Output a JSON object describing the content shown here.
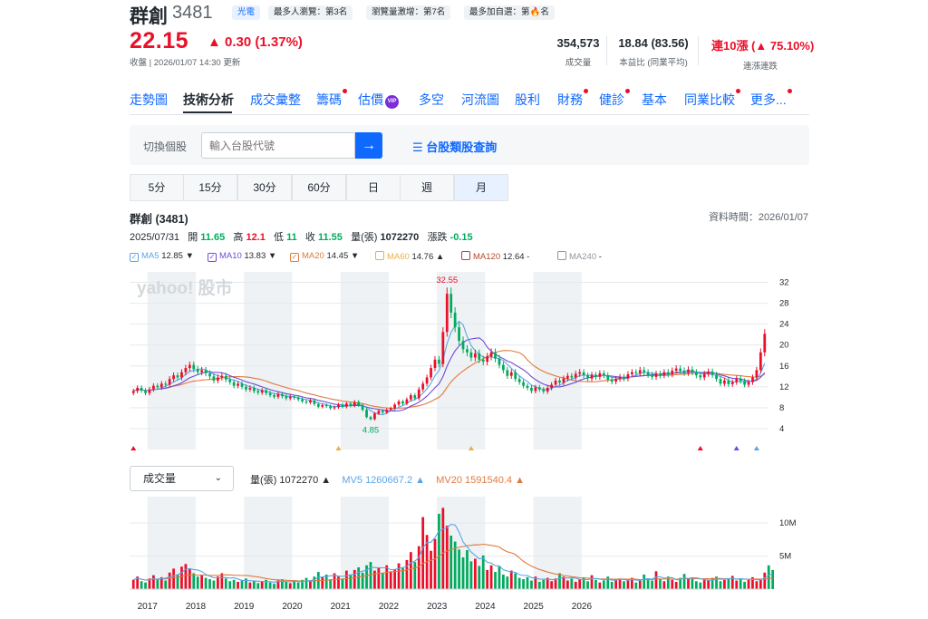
{
  "header": {
    "name": "群創",
    "code": "3481",
    "badges": [
      "光電",
      "最多人瀏覽：第3名",
      "瀏覽量激增：第7名",
      "最多加自選：第🔥名"
    ],
    "price": "22.15",
    "change": "▲ 0.30 (1.37%)",
    "updated": "收盤 | 2026/01/07 14:30 更新",
    "stats": [
      {
        "value": "354,573",
        "label": "成交量"
      },
      {
        "value": "18.84 (83.56)",
        "label": "本益比 (同業平均)"
      },
      {
        "value": "連10漲 (▲ 75.10%)",
        "label": "連漲連跌"
      }
    ]
  },
  "tabs": [
    "走勢圖",
    "技術分析",
    "成交彙整",
    "籌碼",
    "估價",
    "多空",
    "河流圖",
    "股利",
    "財務",
    "健診",
    "基本",
    "同業比較",
    "更多..."
  ],
  "active_tab": "技術分析",
  "vip_label": "VIP",
  "search": {
    "label": "切換個股",
    "placeholder": "輸入台股代號",
    "button_icon": "arrow-right-icon",
    "category_link": "台股類股查詢"
  },
  "periods": [
    "5分",
    "15分",
    "30分",
    "60分",
    "日",
    "週",
    "月"
  ],
  "active_period": "月",
  "chart_header": {
    "title": "群創 (3481)",
    "data_time": "資料時間：2026/01/07",
    "date": "2025/07/31",
    "open_label": "開",
    "open": "11.65",
    "high_label": "高",
    "high": "12.1",
    "low_label": "低",
    "low": "11",
    "close_label": "收",
    "close": "11.55",
    "vol_label": "量(張)",
    "vol": "1072270",
    "chg_label": "漲跌",
    "chg": "-0.15"
  },
  "ma_legend": [
    {
      "label": "MA5",
      "value": "12.85 ▼",
      "color": "#5aa5e8",
      "checked": true
    },
    {
      "label": "MA10",
      "value": "13.83 ▼",
      "color": "#6f4bd8",
      "checked": true
    },
    {
      "label": "MA20",
      "value": "14.45 ▼",
      "color": "#e07a3f",
      "checked": true
    },
    {
      "label": "MA60",
      "value": "14.76 ▲",
      "color": "#e8b04a",
      "checked": false
    },
    {
      "label": "MA120",
      "value": "12.64 -",
      "color": "#b7472a",
      "checked": false
    },
    {
      "label": "MA240",
      "value": "-",
      "color": "#8f969c",
      "checked": false
    }
  ],
  "volume_selector": "成交量",
  "volume_legend": {
    "vol": "量(張) 1072270 ▲",
    "mv5": "MV5 1260667.2 ▲",
    "mv20": "MV20 1591540.4 ▲"
  },
  "watermark": "yahoo! 股市",
  "colors": {
    "up": "#eb0f29",
    "down": "#00ab5e",
    "accent": "#0f69ff"
  },
  "chart_data": {
    "type": "candlestick",
    "y_ticks": [
      4,
      8,
      12,
      16,
      20,
      24,
      28,
      32
    ],
    "ylim": [
      0,
      34
    ],
    "x_ticks": [
      "2017",
      "2018",
      "2019",
      "2020",
      "2021",
      "2022",
      "2023",
      "2024",
      "2025",
      "2026"
    ],
    "annotations": [
      {
        "label": "32.55",
        "kind": "max"
      },
      {
        "label": "4.85",
        "kind": "min"
      }
    ],
    "close": [
      11.2,
      11.8,
      11.3,
      10.8,
      11.5,
      12.2,
      11.9,
      12.6,
      12.4,
      13.5,
      14.2,
      13.8,
      14.8,
      15.6,
      16.2,
      15.4,
      14.8,
      15.2,
      14.6,
      14.0,
      13.2,
      13.8,
      14.1,
      13.4,
      12.9,
      12.2,
      12.6,
      12.0,
      11.5,
      11.8,
      11.2,
      10.9,
      11.3,
      10.8,
      10.4,
      10.1,
      10.6,
      10.2,
      9.8,
      10.1,
      9.9,
      9.6,
      9.2,
      9.0,
      9.4,
      8.7,
      8.2,
      8.5,
      8.3,
      7.9,
      8.1,
      8.6,
      8.2,
      8.8,
      8.4,
      9.1,
      8.5,
      7.6,
      6.2,
      5.8,
      6.9,
      7.4,
      7.1,
      7.6,
      7.9,
      8.6,
      9.2,
      8.8,
      9.6,
      10.4,
      9.8,
      11.5,
      12.6,
      13.8,
      15.6,
      17.2,
      16.4,
      22.5,
      29.8,
      26.2,
      23.4,
      20.8,
      19.2,
      18.6,
      17.6,
      18.4,
      17.2,
      16.8,
      17.8,
      18.6,
      17.4,
      16.2,
      15.2,
      14.1,
      14.8,
      13.5,
      12.9,
      12.2,
      11.8,
      11.2,
      11.9,
      11.5,
      11.1,
      11.8,
      12.4,
      13.2,
      12.8,
      13.6,
      14.1,
      13.8,
      14.5,
      14.8,
      14.2,
      13.6,
      14.3,
      13.9,
      14.6,
      14.2,
      13.4,
      13.0,
      13.5,
      13.9,
      13.6,
      14.4,
      14.8,
      14.6,
      15.2,
      14.8,
      14.3,
      13.9,
      14.5,
      14.2,
      14.8,
      14.4,
      15.1,
      15.5,
      15.1,
      14.7,
      15.3,
      14.8,
      14.2,
      13.8,
      14.5,
      14.9,
      14.3,
      13.5,
      12.6,
      13.2,
      12.5,
      12.9,
      13.6,
      13.1,
      12.4,
      12.9,
      13.8,
      15.2,
      18.6,
      22.15
    ],
    "open": [
      10.8,
      11.2,
      11.8,
      11.3,
      10.8,
      11.5,
      12.2,
      11.9,
      12.6,
      12.4,
      13.5,
      14.2,
      13.8,
      14.8,
      15.6,
      16.2,
      15.4,
      14.8,
      15.2,
      14.6,
      14.0,
      13.2,
      13.8,
      14.1,
      13.4,
      12.9,
      12.2,
      12.6,
      12.0,
      11.5,
      11.8,
      11.2,
      10.9,
      11.3,
      10.8,
      10.4,
      10.1,
      10.6,
      10.2,
      9.8,
      10.1,
      9.9,
      9.6,
      9.2,
      9.0,
      9.4,
      8.7,
      8.2,
      8.5,
      8.3,
      7.9,
      8.1,
      8.6,
      8.2,
      8.8,
      8.4,
      9.1,
      8.5,
      7.6,
      6.2,
      5.8,
      6.9,
      7.4,
      7.1,
      7.6,
      7.9,
      8.6,
      9.2,
      8.8,
      9.6,
      10.4,
      9.8,
      11.5,
      12.6,
      13.8,
      15.6,
      17.2,
      16.4,
      22.5,
      29.8,
      26.2,
      23.4,
      20.8,
      19.2,
      18.6,
      17.6,
      18.4,
      17.2,
      16.8,
      17.8,
      18.6,
      17.4,
      16.2,
      15.2,
      14.1,
      14.8,
      13.5,
      12.9,
      12.2,
      11.8,
      11.2,
      11.9,
      11.5,
      11.1,
      11.8,
      12.4,
      13.2,
      12.8,
      13.6,
      14.1,
      13.8,
      14.5,
      14.8,
      14.2,
      13.6,
      14.3,
      13.9,
      14.6,
      14.2,
      13.4,
      13.0,
      13.5,
      13.9,
      13.6,
      14.4,
      14.8,
      14.6,
      15.2,
      14.8,
      14.3,
      13.9,
      14.5,
      14.2,
      14.8,
      14.4,
      15.1,
      15.5,
      15.1,
      14.7,
      15.3,
      14.8,
      14.2,
      13.8,
      14.5,
      14.9,
      14.3,
      13.5,
      12.6,
      13.2,
      12.5,
      12.9,
      13.6,
      13.1,
      12.4,
      12.9,
      13.8,
      15.2,
      18.6
    ],
    "volume_ticks": [
      "5M",
      "10M"
    ],
    "volume_m": [
      1.4,
      1.9,
      1.2,
      1.0,
      1.6,
      2.1,
      1.5,
      1.8,
      1.3,
      2.5,
      3.1,
      2.2,
      3.4,
      3.8,
      3.0,
      2.4,
      1.9,
      2.2,
      1.7,
      1.5,
      1.3,
      1.9,
      2.4,
      1.6,
      1.2,
      1.4,
      1.1,
      1.3,
      1.6,
      1.0,
      1.2,
      0.9,
      1.1,
      1.4,
      1.0,
      0.8,
      1.3,
      1.5,
      1.1,
      0.9,
      1.2,
      1.0,
      1.4,
      1.7,
      1.2,
      1.9,
      2.6,
      1.8,
      2.2,
      1.5,
      2.4,
      1.9,
      1.6,
      2.8,
      2.1,
      2.9,
      3.3,
      2.5,
      3.6,
      4.1,
      2.8,
      3.2,
      2.4,
      3.6,
      2.7,
      3.0,
      3.9,
      3.2,
      4.4,
      5.6,
      4.1,
      6.5,
      10.9,
      8.2,
      5.8,
      7.6,
      11.4,
      12.3,
      9.6,
      8.1,
      7.2,
      6.0,
      4.8,
      5.9,
      4.2,
      4.6,
      3.5,
      5.1,
      2.9,
      3.6,
      2.6,
      3.4,
      2.2,
      1.9,
      2.8,
      2.4,
      1.7,
      1.5,
      1.8,
      1.3,
      1.9,
      1.1,
      1.4,
      1.7,
      1.2,
      1.6,
      2.4,
      1.9,
      1.3,
      1.6,
      1.1,
      1.5,
      1.8,
      1.2,
      2.1,
      1.4,
      1.0,
      1.3,
      1.9,
      1.1,
      1.5,
      1.6,
      1.2,
      1.3,
      1.7,
      1.0,
      1.4,
      2.2,
      1.6,
      1.3,
      2.7,
      1.5,
      1.2,
      1.9,
      1.4,
      1.1,
      1.7,
      2.3,
      1.6,
      1.8,
      1.2,
      1.0,
      1.5,
      1.3,
      1.7,
      1.9,
      1.2,
      1.4,
      1.6,
      2.0,
      1.3,
      1.6,
      1.1,
      1.4,
      1.8,
      1.2,
      1.5,
      2.5,
      3.6,
      2.9
    ],
    "volume_series": [
      "量(張)",
      "MV5",
      "MV20"
    ]
  }
}
